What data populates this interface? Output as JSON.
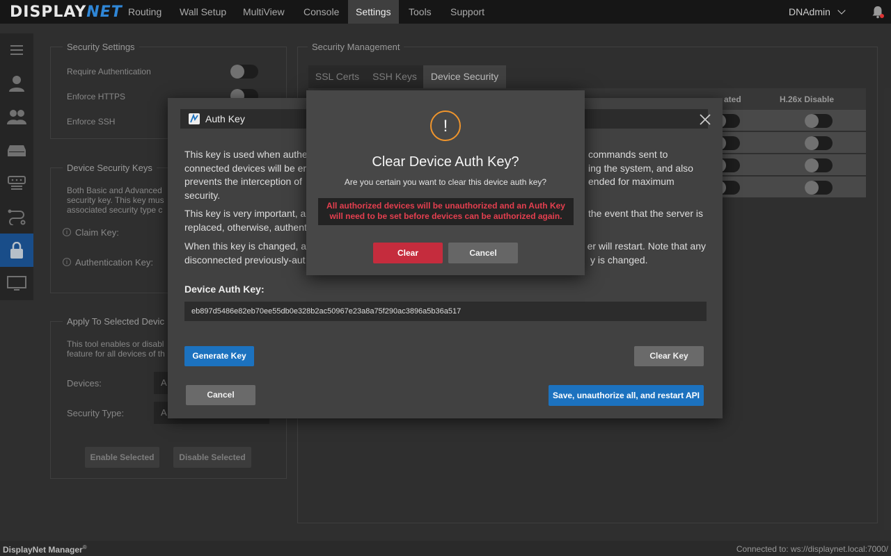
{
  "app": {
    "logo_left": "DISPLAY",
    "logo_right": "NET"
  },
  "nav": {
    "items": [
      "Routing",
      "Wall Setup",
      "MultiView",
      "Console",
      "Settings",
      "Tools",
      "Support"
    ],
    "active": "Settings",
    "user": "DNAdmin"
  },
  "security_settings": {
    "title": "Security Settings",
    "require_auth": "Require Authentication",
    "enforce_https": "Enforce HTTPS",
    "enforce_ssh": "Enforce SSH"
  },
  "device_security_keys": {
    "title": "Device Security Keys",
    "desc": "Both Basic and Advanced security key. This key mus associated security type c",
    "claim_key": "Claim Key:",
    "auth_key": "Authentication Key:"
  },
  "apply_selected": {
    "title": "Apply To Selected Devic",
    "desc": "This tool enables or disabl feature for all devices of th",
    "devices_label": "Devices:",
    "devices_value": "A",
    "type_label": "Security Type:",
    "type_value": "A",
    "enable_btn": "Enable Selected",
    "disable_btn": "Disable Selected"
  },
  "security_mgmt": {
    "title": "Security Management",
    "tabs": [
      "SSL Certs",
      "SSH Keys",
      "Device Security"
    ],
    "active_tab": "Device Security",
    "col_authenticated": "ated",
    "col_h26x": "H.26x Disable"
  },
  "auth_dialog": {
    "title": "Auth Key",
    "para1": "This key is used when authe commands sent to connected devices will be en ing the system, and also prevents the interception of ended for maximum security.",
    "para1_lines": [
      "This key is used when authe",
      "connected devices will be en",
      "prevents the interception of",
      "security."
    ],
    "para1_right": [
      "commands sent to",
      "ing the system, and also",
      "ended for maximum"
    ],
    "para2_lines": [
      "This key is very important, an",
      "replaced, otherwise, authent"
    ],
    "para2_right": [
      "the event that the server is"
    ],
    "para3_lines": [
      "When this key is changed, al",
      "disconnected previously-aut"
    ],
    "para3_right": [
      "er will restart. Note that any",
      "y is changed."
    ],
    "key_label": "Device Auth Key:",
    "key_value": "eb897d5486e82eb70ee55db0e328b2ac50967e23a8a75f290ac3896a5b36a517",
    "generate_btn": "Generate Key",
    "clear_key_btn": "Clear Key",
    "cancel_btn": "Cancel",
    "save_btn": "Save, unauthorize all, and restart API"
  },
  "confirm_dialog": {
    "icon": "!",
    "title": "Clear Device Auth Key?",
    "subtitle": "Are you certain you want to clear this device auth key?",
    "warning_line1": "All authorized devices will be unauthorized and an Auth Key",
    "warning_line2": "will need to be set before devices can be authorized again.",
    "clear_btn": "Clear",
    "cancel_btn": "Cancel"
  },
  "footer": {
    "left": "DisplayNet Manager",
    "mark": "®",
    "right": "Connected to: ws://displaynet.local:7000/"
  },
  "colors": {
    "accent_blue": "#1c72bf",
    "danger_red": "#c52c3d",
    "warn_orange": "#f0952c",
    "warn_text": "#e53f4f"
  }
}
